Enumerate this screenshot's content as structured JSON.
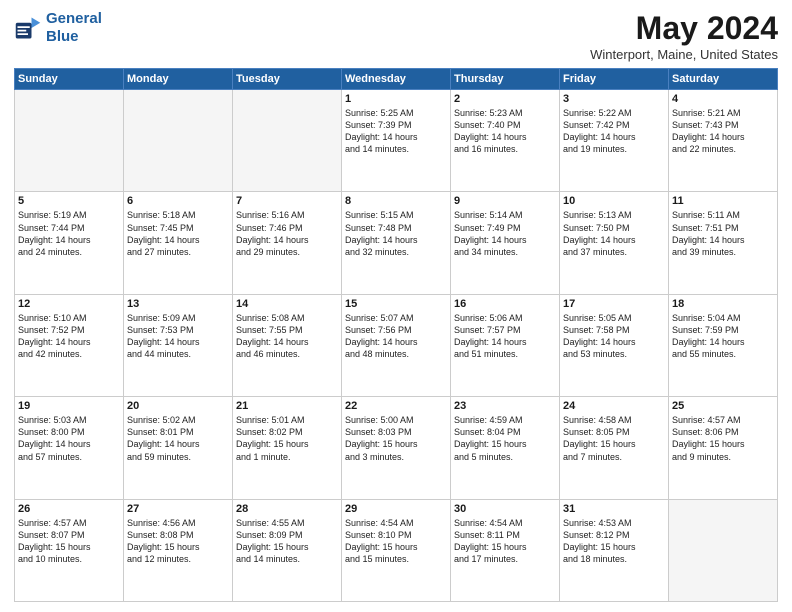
{
  "header": {
    "logo_line1": "General",
    "logo_line2": "Blue",
    "month": "May 2024",
    "location": "Winterport, Maine, United States"
  },
  "weekdays": [
    "Sunday",
    "Monday",
    "Tuesday",
    "Wednesday",
    "Thursday",
    "Friday",
    "Saturday"
  ],
  "weeks": [
    [
      {
        "day": "",
        "info": ""
      },
      {
        "day": "",
        "info": ""
      },
      {
        "day": "",
        "info": ""
      },
      {
        "day": "1",
        "info": "Sunrise: 5:25 AM\nSunset: 7:39 PM\nDaylight: 14 hours\nand 14 minutes."
      },
      {
        "day": "2",
        "info": "Sunrise: 5:23 AM\nSunset: 7:40 PM\nDaylight: 14 hours\nand 16 minutes."
      },
      {
        "day": "3",
        "info": "Sunrise: 5:22 AM\nSunset: 7:42 PM\nDaylight: 14 hours\nand 19 minutes."
      },
      {
        "day": "4",
        "info": "Sunrise: 5:21 AM\nSunset: 7:43 PM\nDaylight: 14 hours\nand 22 minutes."
      }
    ],
    [
      {
        "day": "5",
        "info": "Sunrise: 5:19 AM\nSunset: 7:44 PM\nDaylight: 14 hours\nand 24 minutes."
      },
      {
        "day": "6",
        "info": "Sunrise: 5:18 AM\nSunset: 7:45 PM\nDaylight: 14 hours\nand 27 minutes."
      },
      {
        "day": "7",
        "info": "Sunrise: 5:16 AM\nSunset: 7:46 PM\nDaylight: 14 hours\nand 29 minutes."
      },
      {
        "day": "8",
        "info": "Sunrise: 5:15 AM\nSunset: 7:48 PM\nDaylight: 14 hours\nand 32 minutes."
      },
      {
        "day": "9",
        "info": "Sunrise: 5:14 AM\nSunset: 7:49 PM\nDaylight: 14 hours\nand 34 minutes."
      },
      {
        "day": "10",
        "info": "Sunrise: 5:13 AM\nSunset: 7:50 PM\nDaylight: 14 hours\nand 37 minutes."
      },
      {
        "day": "11",
        "info": "Sunrise: 5:11 AM\nSunset: 7:51 PM\nDaylight: 14 hours\nand 39 minutes."
      }
    ],
    [
      {
        "day": "12",
        "info": "Sunrise: 5:10 AM\nSunset: 7:52 PM\nDaylight: 14 hours\nand 42 minutes."
      },
      {
        "day": "13",
        "info": "Sunrise: 5:09 AM\nSunset: 7:53 PM\nDaylight: 14 hours\nand 44 minutes."
      },
      {
        "day": "14",
        "info": "Sunrise: 5:08 AM\nSunset: 7:55 PM\nDaylight: 14 hours\nand 46 minutes."
      },
      {
        "day": "15",
        "info": "Sunrise: 5:07 AM\nSunset: 7:56 PM\nDaylight: 14 hours\nand 48 minutes."
      },
      {
        "day": "16",
        "info": "Sunrise: 5:06 AM\nSunset: 7:57 PM\nDaylight: 14 hours\nand 51 minutes."
      },
      {
        "day": "17",
        "info": "Sunrise: 5:05 AM\nSunset: 7:58 PM\nDaylight: 14 hours\nand 53 minutes."
      },
      {
        "day": "18",
        "info": "Sunrise: 5:04 AM\nSunset: 7:59 PM\nDaylight: 14 hours\nand 55 minutes."
      }
    ],
    [
      {
        "day": "19",
        "info": "Sunrise: 5:03 AM\nSunset: 8:00 PM\nDaylight: 14 hours\nand 57 minutes."
      },
      {
        "day": "20",
        "info": "Sunrise: 5:02 AM\nSunset: 8:01 PM\nDaylight: 14 hours\nand 59 minutes."
      },
      {
        "day": "21",
        "info": "Sunrise: 5:01 AM\nSunset: 8:02 PM\nDaylight: 15 hours\nand 1 minute."
      },
      {
        "day": "22",
        "info": "Sunrise: 5:00 AM\nSunset: 8:03 PM\nDaylight: 15 hours\nand 3 minutes."
      },
      {
        "day": "23",
        "info": "Sunrise: 4:59 AM\nSunset: 8:04 PM\nDaylight: 15 hours\nand 5 minutes."
      },
      {
        "day": "24",
        "info": "Sunrise: 4:58 AM\nSunset: 8:05 PM\nDaylight: 15 hours\nand 7 minutes."
      },
      {
        "day": "25",
        "info": "Sunrise: 4:57 AM\nSunset: 8:06 PM\nDaylight: 15 hours\nand 9 minutes."
      }
    ],
    [
      {
        "day": "26",
        "info": "Sunrise: 4:57 AM\nSunset: 8:07 PM\nDaylight: 15 hours\nand 10 minutes."
      },
      {
        "day": "27",
        "info": "Sunrise: 4:56 AM\nSunset: 8:08 PM\nDaylight: 15 hours\nand 12 minutes."
      },
      {
        "day": "28",
        "info": "Sunrise: 4:55 AM\nSunset: 8:09 PM\nDaylight: 15 hours\nand 14 minutes."
      },
      {
        "day": "29",
        "info": "Sunrise: 4:54 AM\nSunset: 8:10 PM\nDaylight: 15 hours\nand 15 minutes."
      },
      {
        "day": "30",
        "info": "Sunrise: 4:54 AM\nSunset: 8:11 PM\nDaylight: 15 hours\nand 17 minutes."
      },
      {
        "day": "31",
        "info": "Sunrise: 4:53 AM\nSunset: 8:12 PM\nDaylight: 15 hours\nand 18 minutes."
      },
      {
        "day": "",
        "info": ""
      }
    ]
  ]
}
